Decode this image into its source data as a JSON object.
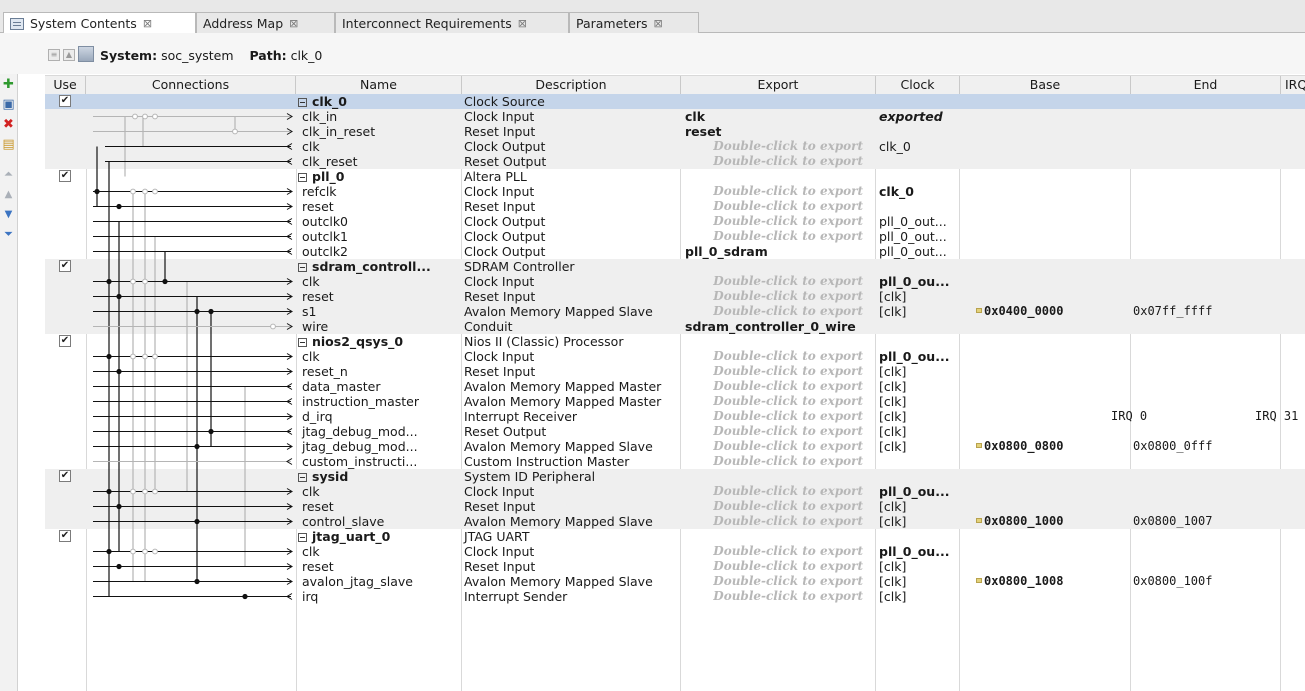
{
  "tabs": [
    {
      "label": "System Contents",
      "active": true
    },
    {
      "label": "Address Map",
      "active": false
    },
    {
      "label": "Interconnect Requirements",
      "active": false
    },
    {
      "label": "Parameters",
      "active": false
    }
  ],
  "tab_close_glyph": "⊠",
  "path_bar": {
    "system_label": "System:",
    "system_value": "soc_system",
    "path_label": "Path:",
    "path_value": "clk_0"
  },
  "columns": [
    "Use",
    "Connections",
    "Name",
    "Description",
    "Export",
    "Clock",
    "Base",
    "End",
    "IRQ"
  ],
  "export_placeholder": "Double-click to export",
  "rows": [
    {
      "type": "comp",
      "name": "clk_0",
      "desc": "Clock Source",
      "use": true,
      "selected": true
    },
    {
      "name": "clk_in",
      "desc": "Clock Input",
      "export": "clk",
      "clock": "exported",
      "clockStyle": "exported"
    },
    {
      "name": "clk_in_reset",
      "desc": "Reset Input",
      "export": "reset"
    },
    {
      "name": "clk",
      "desc": "Clock Output",
      "ph": true,
      "clock": "clk_0"
    },
    {
      "name": "clk_reset",
      "desc": "Reset Output",
      "ph": true
    },
    {
      "type": "comp",
      "name": "pll_0",
      "desc": "Altera PLL",
      "use": true
    },
    {
      "name": "refclk",
      "desc": "Clock Input",
      "ph": true,
      "clock": "clk_0",
      "clockStyle": "bold"
    },
    {
      "name": "reset",
      "desc": "Reset Input",
      "ph": true
    },
    {
      "name": "outclk0",
      "desc": "Clock Output",
      "ph": true,
      "clock": "pll_0_out..."
    },
    {
      "name": "outclk1",
      "desc": "Clock Output",
      "ph": true,
      "clock": "pll_0_out..."
    },
    {
      "name": "outclk2",
      "desc": "Clock Output",
      "export": "pll_0_sdram",
      "clock": "pll_0_out..."
    },
    {
      "type": "comp",
      "name": "sdram_controll...",
      "desc": "SDRAM Controller",
      "use": true
    },
    {
      "name": "clk",
      "desc": "Clock Input",
      "ph": true,
      "clock": "pll_0_ou...",
      "clockStyle": "bold"
    },
    {
      "name": "reset",
      "desc": "Reset Input",
      "ph": true,
      "clock": "[clk]"
    },
    {
      "name": "s1",
      "desc": "Avalon Memory Mapped Slave",
      "ph": true,
      "clock": "[clk]",
      "base": "0x0400_0000",
      "end": "0x07ff_ffff"
    },
    {
      "name": "wire",
      "desc": "Conduit",
      "export": "sdram_controller_0_wire"
    },
    {
      "type": "comp",
      "name": "nios2_qsys_0",
      "desc": "Nios II (Classic) Processor",
      "use": true
    },
    {
      "name": "clk",
      "desc": "Clock Input",
      "ph": true,
      "clock": "pll_0_ou...",
      "clockStyle": "bold"
    },
    {
      "name": "reset_n",
      "desc": "Reset Input",
      "ph": true,
      "clock": "[clk]"
    },
    {
      "name": "data_master",
      "desc": "Avalon Memory Mapped Master",
      "ph": true,
      "clock": "[clk]"
    },
    {
      "name": "instruction_master",
      "desc": "Avalon Memory Mapped Master",
      "ph": true,
      "clock": "[clk]"
    },
    {
      "name": "d_irq",
      "desc": "Interrupt Receiver",
      "ph": true,
      "clock": "[clk]",
      "irqLeft": "IRQ 0",
      "irqRight": "IRQ 31"
    },
    {
      "name": "jtag_debug_mod...",
      "desc": "Reset Output",
      "ph": true,
      "clock": "[clk]"
    },
    {
      "name": "jtag_debug_mod...",
      "desc": "Avalon Memory Mapped Slave",
      "ph": true,
      "clock": "[clk]",
      "base": "0x0800_0800",
      "end": "0x0800_0fff"
    },
    {
      "name": "custom_instructi...",
      "desc": "Custom Instruction Master",
      "ph": true
    },
    {
      "type": "comp",
      "name": "sysid",
      "desc": "System ID Peripheral",
      "use": true
    },
    {
      "name": "clk",
      "desc": "Clock Input",
      "ph": true,
      "clock": "pll_0_ou...",
      "clockStyle": "bold"
    },
    {
      "name": "reset",
      "desc": "Reset Input",
      "ph": true,
      "clock": "[clk]"
    },
    {
      "name": "control_slave",
      "desc": "Avalon Memory Mapped Slave",
      "ph": true,
      "clock": "[clk]",
      "base": "0x0800_1000",
      "end": "0x0800_1007"
    },
    {
      "type": "comp",
      "name": "jtag_uart_0",
      "desc": "JTAG UART",
      "use": true
    },
    {
      "name": "clk",
      "desc": "Clock Input",
      "ph": true,
      "clock": "pll_0_ou...",
      "clockStyle": "bold"
    },
    {
      "name": "reset",
      "desc": "Reset Input",
      "ph": true,
      "clock": "[clk]"
    },
    {
      "name": "avalon_jtag_slave",
      "desc": "Avalon Memory Mapped Slave",
      "ph": true,
      "clock": "[clk]",
      "base": "0x0800_1008",
      "end": "0x0800_100f"
    },
    {
      "name": "irq",
      "desc": "Interrupt Sender",
      "ph": true,
      "clock": "[clk]"
    }
  ]
}
